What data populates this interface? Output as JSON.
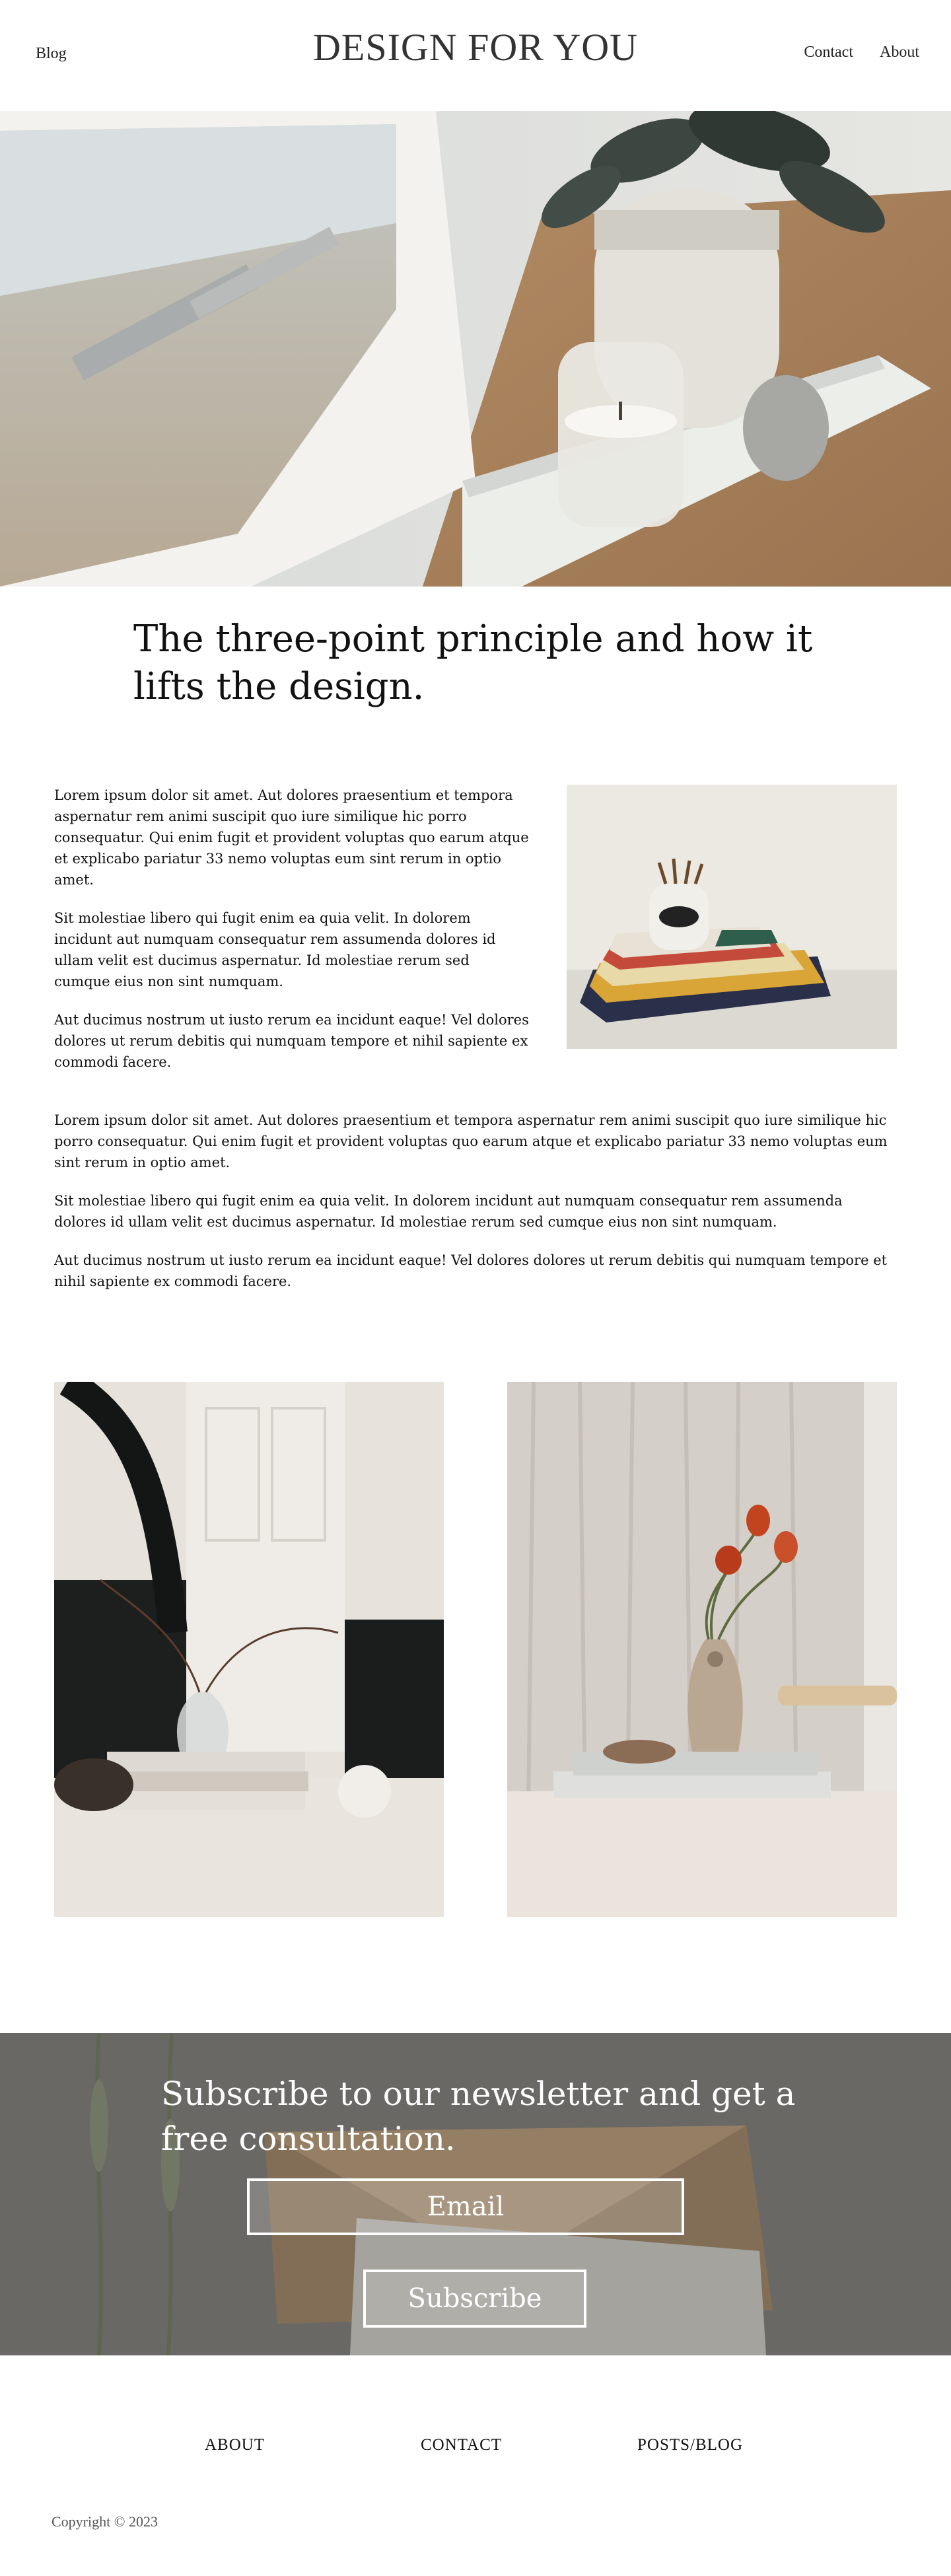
{
  "header": {
    "nav_left": "Blog",
    "site_title": "DESIGN FOR YOU",
    "nav_right": [
      "Contact",
      "About"
    ]
  },
  "article": {
    "headline": "The three-point principle and how it lifts the design.",
    "col_paragraphs": [
      "Lorem ipsum dolor sit amet. Aut dolores praesentium et tempora aspernatur rem animi suscipit quo iure similique hic porro consequatur. Qui enim fugit et provident voluptas quo earum atque et explicabo pariatur 33 nemo voluptas eum sint rerum in optio amet.",
      "Sit molestiae libero qui fugit enim ea quia velit. In dolorem incidunt aut numquam consequatur rem assumenda dolores id ullam velit est ducimus aspernatur. Id molestiae rerum sed cumque eius non sint numquam.",
      "Aut ducimus nostrum ut iusto rerum ea incidunt eaque! Vel dolores dolores ut rerum debitis qui numquam tempore et nihil sapiente ex commodi facere."
    ],
    "full_paragraphs": [
      "Lorem ipsum dolor sit amet. Aut dolores praesentium et tempora aspernatur rem animi suscipit quo iure similique hic porro consequatur. Qui enim fugit et provident voluptas quo earum atque et explicabo pariatur 33 nemo voluptas eum sint rerum in optio amet.",
      "Sit molestiae libero qui fugit enim ea quia velit. In dolorem incidunt aut numquam consequatur rem assumenda dolores id ullam velit est ducimus aspernatur. Id molestiae rerum sed cumque eius non sint numquam.",
      "Aut ducimus nostrum ut iusto rerum ea incidunt eaque! Vel dolores dolores ut rerum debitis qui numquam tempore et nihil sapiente ex commodi facere."
    ]
  },
  "newsletter": {
    "title": "Subscribe to our newsletter and get a free consultation.",
    "email_placeholder": "Email",
    "button_label": "Subscribe"
  },
  "footer": {
    "links": [
      "ABOUT",
      "CONTACT",
      "POSTS/BLOG"
    ],
    "copyright": "Copyright © 2023"
  },
  "colors": {
    "text": "#111111",
    "newsletter_overlay": "#6f6e6c",
    "white": "#ffffff"
  }
}
